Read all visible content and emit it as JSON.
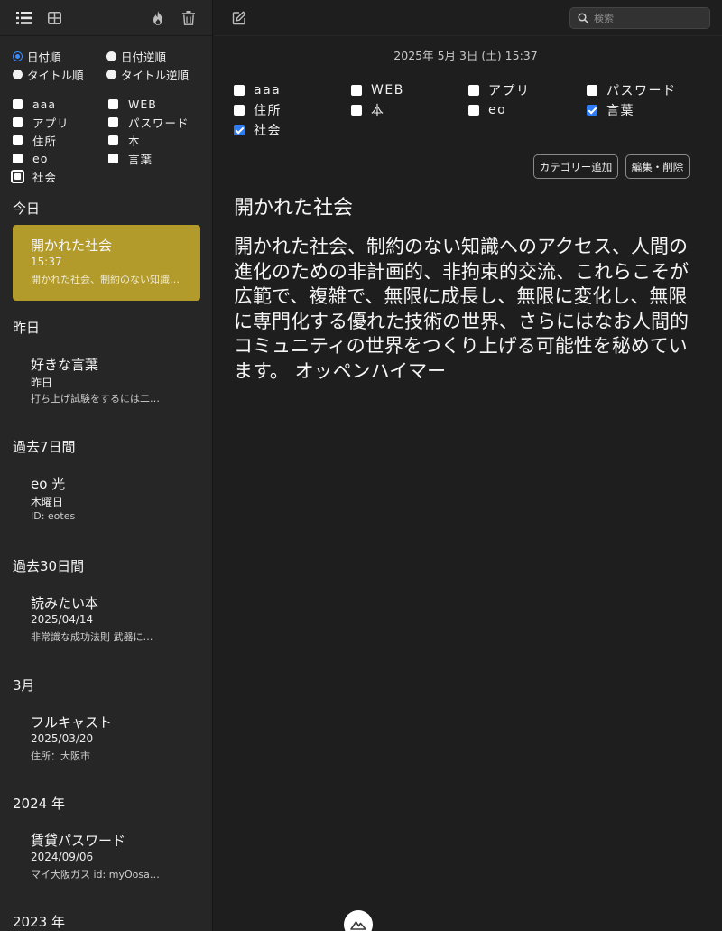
{
  "sidebar": {
    "sort_options": [
      {
        "label": "日付順",
        "selected": true
      },
      {
        "label": "日付逆順",
        "selected": false
      },
      {
        "label": "タイトル順",
        "selected": false
      },
      {
        "label": "タイトル逆順",
        "selected": false
      }
    ],
    "categories": [
      "aaa",
      "WEB",
      "アプリ",
      "パスワード",
      "住所",
      "本",
      "eo",
      "言葉",
      "社会"
    ],
    "sections": [
      {
        "heading": "今日",
        "note": {
          "title": "開かれた社会",
          "sub": "15:37",
          "preview": "開かれた社会、制約のない知識へのアクセス、"
        }
      },
      {
        "heading": "昨日",
        "note": {
          "title": "好きな言葉",
          "sub": "昨日",
          "preview": "打ち上げ試験をするには二…"
        }
      },
      {
        "heading": "過去7日間",
        "note": {
          "title": "eo 光",
          "sub": "木曜日",
          "preview": "ID: eotes"
        }
      },
      {
        "heading": "過去30日間",
        "note": {
          "title": "読みたい本",
          "sub": "2025/04/14",
          "preview": "非常識な成功法則 武器に…"
        }
      },
      {
        "heading": "3月",
        "note": {
          "title": "フルキャスト",
          "sub": "2025/03/20",
          "preview": "住所：大阪市"
        }
      },
      {
        "heading": "2024 年",
        "note": {
          "title": "賃貸パスワード",
          "sub": "2024/09/06",
          "preview": "マイ大阪ガス id: myOosa…"
        }
      },
      {
        "heading": "2023 年"
      }
    ]
  },
  "main": {
    "search_placeholder": "検索",
    "date": "2025年 5月 3日 (土) 15:37",
    "categories": [
      {
        "label": "aaa",
        "checked": false
      },
      {
        "label": "WEB",
        "checked": false
      },
      {
        "label": "アプリ",
        "checked": false
      },
      {
        "label": "パスワード",
        "checked": false
      },
      {
        "label": "住所",
        "checked": false
      },
      {
        "label": "本",
        "checked": false
      },
      {
        "label": "eo",
        "checked": false
      },
      {
        "label": "言葉",
        "checked": true
      },
      {
        "label": "社会",
        "checked": true
      }
    ],
    "add_category_label": "カテゴリー追加",
    "edit_delete_label": "編集・削除",
    "note_title": "開かれた社会",
    "note_body": "開かれた社会、制約のない知識へのアクセス、人間の進化のための非計画的、非拘束的交流、これらこそが広範で、複雑で、無限に成長し、無限に変化し、無限に専門化する優れた技術の世界、さらにはなお人間的コミュニティの世界をつくり上げる可能性を秘めています。 オッペンハイマー"
  },
  "colors": {
    "accent": "#3b8bff",
    "selected_note": "#b29b2a",
    "checkbox_checked": "#2e7cf6"
  }
}
